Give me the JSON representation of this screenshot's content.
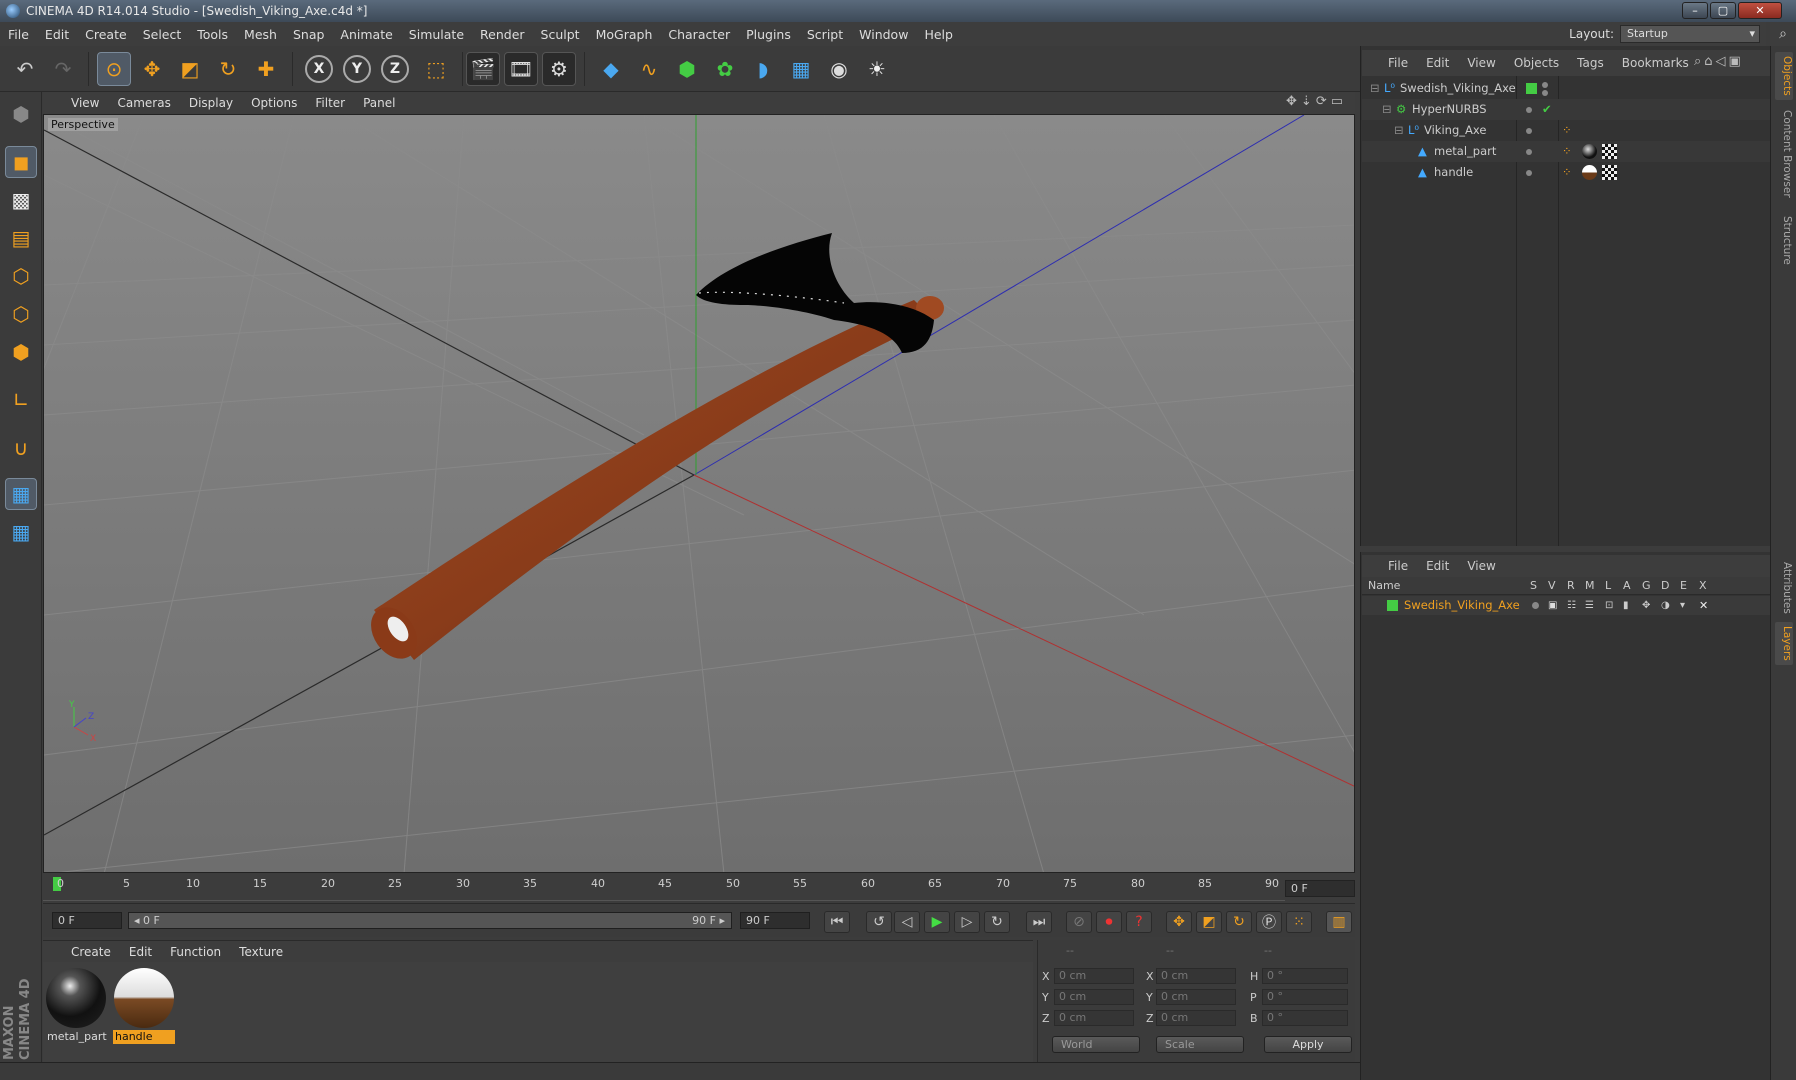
{
  "window": {
    "title": "CINEMA 4D R14.014 Studio - [Swedish_Viking_Axe.c4d *]"
  },
  "menu": [
    "File",
    "Edit",
    "Create",
    "Select",
    "Tools",
    "Mesh",
    "Snap",
    "Animate",
    "Simulate",
    "Render",
    "Sculpt",
    "MoGraph",
    "Character",
    "Plugins",
    "Script",
    "Window",
    "Help"
  ],
  "layout": {
    "label": "Layout:",
    "value": "Startup"
  },
  "viewport": {
    "menu": [
      "View",
      "Cameras",
      "Display",
      "Options",
      "Filter",
      "Panel"
    ],
    "label": "Perspective",
    "axis_labels": {
      "x": "X",
      "y": "Y",
      "z": "Z"
    }
  },
  "timeline": {
    "ticks": [
      "0",
      "5",
      "10",
      "15",
      "20",
      "25",
      "30",
      "35",
      "40",
      "45",
      "50",
      "55",
      "60",
      "65",
      "70",
      "75",
      "80",
      "85",
      "90"
    ],
    "current_frame": "0 F"
  },
  "transport": {
    "start_field": "0 F",
    "range_start": "◂ 0 F",
    "range_end": "90 F ▸",
    "end_field": "90 F"
  },
  "material_manager": {
    "menu": [
      "Create",
      "Edit",
      "Function",
      "Texture"
    ],
    "materials": [
      {
        "name": "metal_part",
        "selected": false
      },
      {
        "name": "handle",
        "selected": true
      }
    ]
  },
  "coordinates": {
    "headers": [
      "--",
      "--",
      "--"
    ],
    "rows": [
      {
        "a": "X",
        "v1": "0 cm",
        "b": "X",
        "v2": "0 cm",
        "c": "H",
        "v3": "0 °"
      },
      {
        "a": "Y",
        "v1": "0 cm",
        "b": "Y",
        "v2": "0 cm",
        "c": "P",
        "v3": "0 °"
      },
      {
        "a": "Z",
        "v1": "0 cm",
        "b": "Z",
        "v2": "0 cm",
        "c": "B",
        "v3": "0 °"
      }
    ],
    "mode1": "World",
    "mode2": "Scale",
    "apply": "Apply"
  },
  "object_manager": {
    "menu": [
      "File",
      "Edit",
      "View",
      "Objects",
      "Tags",
      "Bookmarks"
    ],
    "objects": [
      {
        "name": "Swedish_Viking_Axe",
        "depth": 0,
        "icon": "null-icon"
      },
      {
        "name": "HyperNURBS",
        "depth": 1,
        "icon": "hypernurbs-icon"
      },
      {
        "name": "Viking_Axe",
        "depth": 2,
        "icon": "null-icon"
      },
      {
        "name": "metal_part",
        "depth": 3,
        "icon": "polygon-icon"
      },
      {
        "name": "handle",
        "depth": 3,
        "icon": "polygon-icon"
      }
    ]
  },
  "layer_manager": {
    "menu": [
      "File",
      "Edit",
      "View"
    ],
    "columns": [
      "Name",
      "S",
      "V",
      "R",
      "M",
      "L",
      "A",
      "G",
      "D",
      "E",
      "X"
    ],
    "layers": [
      {
        "name": "Swedish_Viking_Axe",
        "color": "#44cc44"
      }
    ]
  },
  "side_tabs": [
    "Objects",
    "Content Browser",
    "Structure",
    "Attributes",
    "Layers"
  ],
  "brand": "MAXON CINEMA 4D",
  "colors": {
    "accent": "#f0a020",
    "selection": "#f0a020",
    "layer": "#44cc44"
  }
}
